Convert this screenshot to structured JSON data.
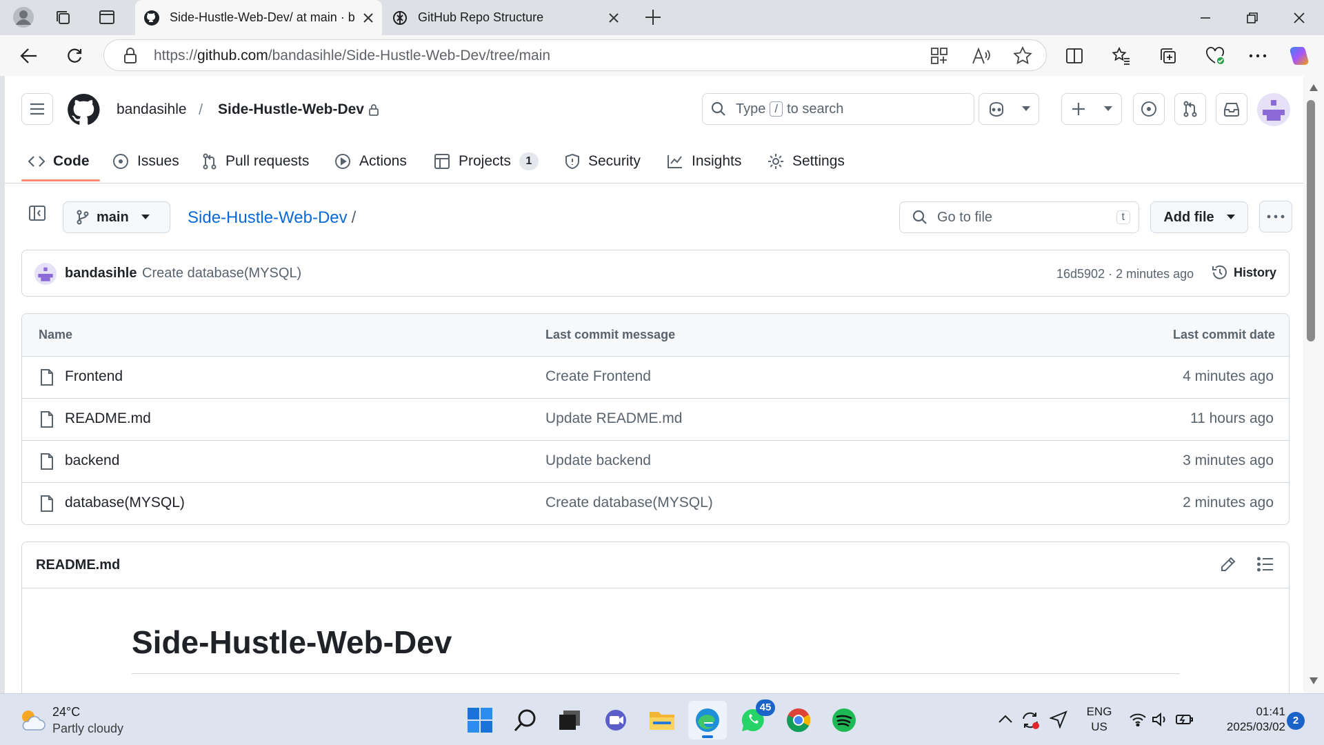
{
  "browser": {
    "tabs": [
      {
        "title": "Side-Hustle-Web-Dev/ at main · b",
        "active": true
      },
      {
        "title": "GitHub Repo Structure",
        "active": false
      }
    ],
    "url_prefix": "https://",
    "url_host": "github.com",
    "url_path": "/bandasihle/Side-Hustle-Web-Dev/tree/main"
  },
  "header": {
    "owner": "bandasihle",
    "separator": "/",
    "repo": "Side-Hustle-Web-Dev",
    "search_prefix": "Type",
    "search_key": "/",
    "search_suffix": "to search"
  },
  "repo_nav": {
    "code": "Code",
    "issues": "Issues",
    "pull_requests": "Pull requests",
    "actions": "Actions",
    "projects": "Projects",
    "projects_count": "1",
    "security": "Security",
    "insights": "Insights",
    "settings": "Settings"
  },
  "toolbar": {
    "branch": "main",
    "breadcrumb_repo": "Side-Hustle-Web-Dev",
    "breadcrumb_sep": "/",
    "go_to_file": "Go to file",
    "go_to_file_key": "t",
    "add_file": "Add file"
  },
  "latest_commit": {
    "author": "bandasihle",
    "message": "Create database(MYSQL)",
    "meta": "16d5902 · 2 minutes ago",
    "history": "History"
  },
  "file_table": {
    "headers": {
      "name": "Name",
      "message": "Last commit message",
      "date": "Last commit date"
    },
    "rows": [
      {
        "name": "Frontend",
        "message": "Create Frontend",
        "date": "4 minutes ago"
      },
      {
        "name": "README.md",
        "message": "Update README.md",
        "date": "11 hours ago"
      },
      {
        "name": "backend",
        "message": "Update backend",
        "date": "3 minutes ago"
      },
      {
        "name": "database(MYSQL)",
        "message": "Create database(MYSQL)",
        "date": "2 minutes ago"
      }
    ]
  },
  "readme": {
    "filename": "README.md",
    "heading": "Side-Hustle-Web-Dev"
  },
  "taskbar": {
    "weather_temp": "24°C",
    "weather_desc": "Partly cloudy",
    "whatsapp_badge": "45",
    "lang_1": "ENG",
    "lang_2": "US",
    "time": "01:41",
    "date": "2025/03/02",
    "notification_count": "2"
  },
  "colors": {
    "accent_link": "#0969da",
    "active_tab_underline": "#fd8c73",
    "taskbar_bg": "#dde4f0"
  }
}
